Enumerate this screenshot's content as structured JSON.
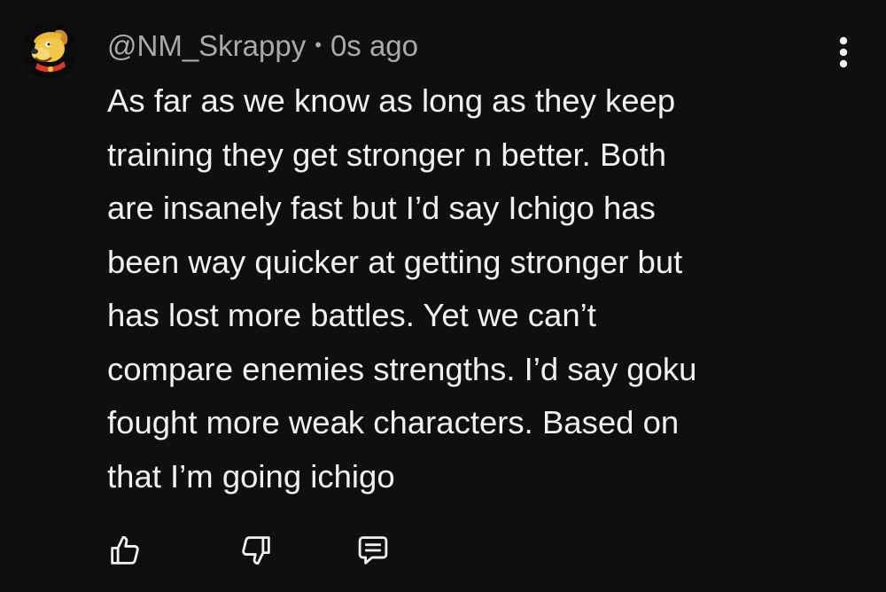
{
  "comment": {
    "author": "@NM_Skrappy",
    "separator": "•",
    "timestamp": "0s ago",
    "body_lines": [
      "As far as we know as long as they keep",
      "training they get stronger n better. Both",
      "are insanely fast but I’d say Ichigo has",
      "been way quicker at getting stronger but",
      "has lost more battles. Yet we can’t",
      "compare enemies strengths. I’d say goku",
      "fought more weak characters. Based on",
      "that I’m going ichigo"
    ],
    "avatar_icon": "cartoon-dog-avatar",
    "more_icon": "vertical-ellipsis-icon"
  },
  "actions": {
    "like_icon": "thumbs-up-icon",
    "dislike_icon": "thumbs-down-icon",
    "reply_icon": "reply-comment-icon"
  },
  "colors": {
    "background": "#0f0f0f",
    "text": "#f1f1f1",
    "meta": "#aaaaaa",
    "icon": "#f1f1f1"
  }
}
